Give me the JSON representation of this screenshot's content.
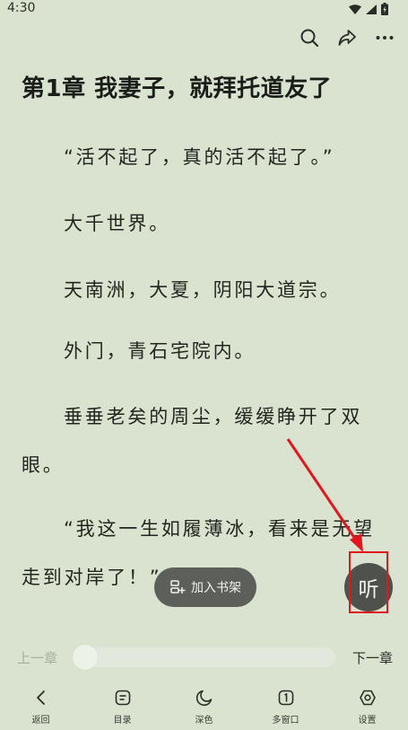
{
  "status": {
    "time": "4:30"
  },
  "toolbar": {
    "icons": [
      "search-icon",
      "share-icon",
      "more-icon"
    ]
  },
  "chapter": {
    "title": "第1章 我妻子，就拜托道友了",
    "paragraphs": [
      "“活不起了，真的活不起了。”",
      "大千世界。",
      "天南洲，大夏，阴阳大道宗。",
      "外门，青石宅院内。",
      "垂垂老矣的周尘，缓缓睁开了双眼。",
      "“我这一生如履薄冰，看来是无望走到对岸了！”"
    ]
  },
  "floating": {
    "add_shelf_label": "加入书架",
    "listen_label": "听"
  },
  "progress": {
    "prev_label": "上一章",
    "next_label": "下一章",
    "value": 0
  },
  "bottom_nav": {
    "items": [
      {
        "label": "返回",
        "icon": "back-icon"
      },
      {
        "label": "目录",
        "icon": "catalog-icon"
      },
      {
        "label": "深色",
        "icon": "moon-icon"
      },
      {
        "label": "多窗口",
        "icon": "multi-window-icon"
      },
      {
        "label": "设置",
        "icon": "settings-icon"
      }
    ]
  },
  "colors": {
    "background": "#d9e3cf",
    "annotation": "#e3161d",
    "button_dark": "#4f524c"
  }
}
